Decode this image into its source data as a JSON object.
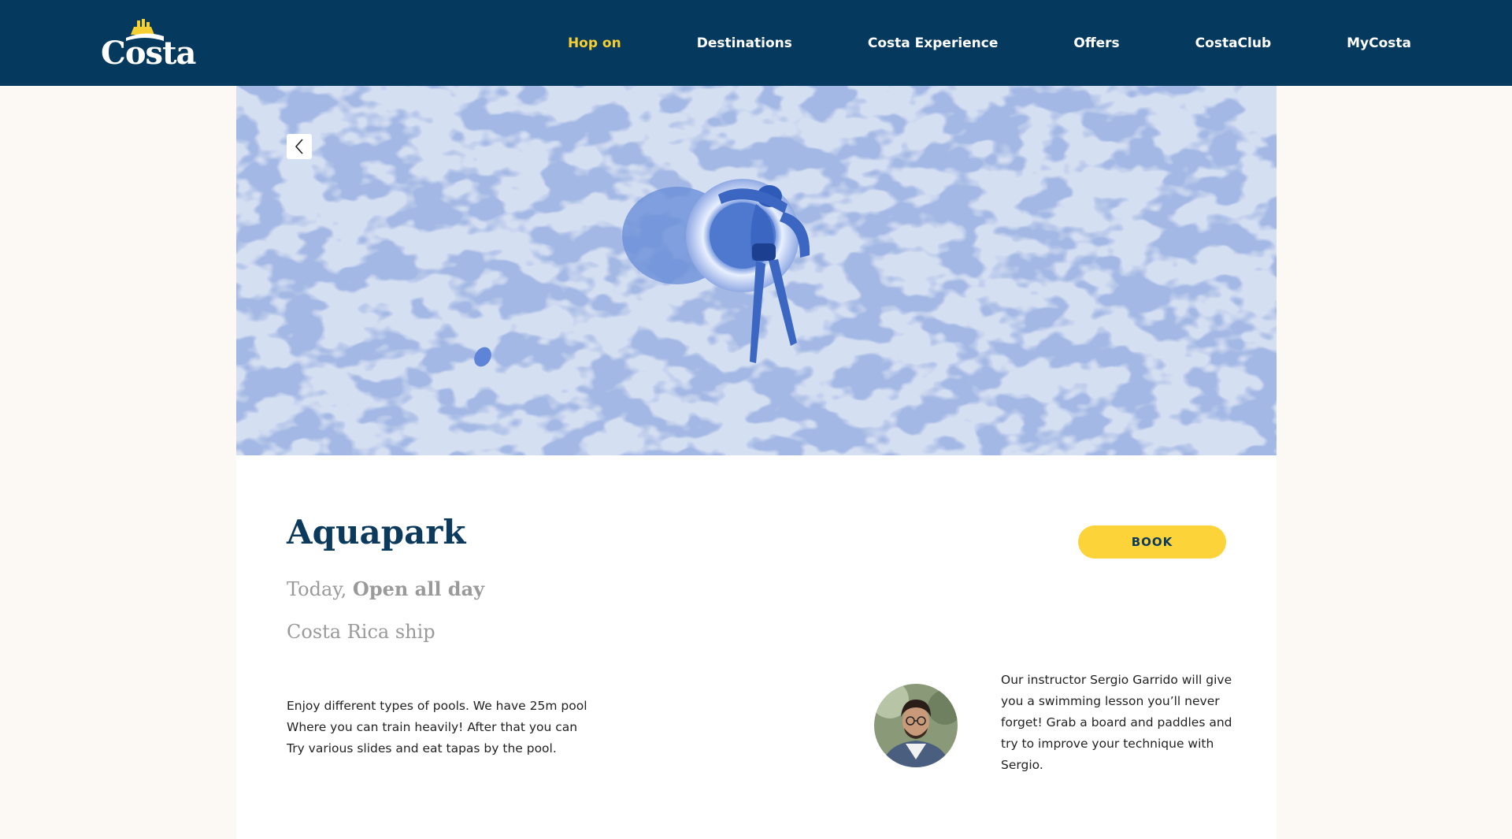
{
  "brand": {
    "logo_text": "Costa",
    "header_color": "#06395e",
    "accent_color": "#f6cf32"
  },
  "nav": {
    "items": [
      {
        "label": "Hop on",
        "active": true
      },
      {
        "label": "Destinations",
        "active": false
      },
      {
        "label": "Costa Experience",
        "active": false
      },
      {
        "label": "Offers",
        "active": false
      },
      {
        "label": "CostaClub",
        "active": false
      },
      {
        "label": "MyCosta",
        "active": false
      }
    ]
  },
  "hero": {
    "prev_icon": "chevron-left-icon"
  },
  "activity": {
    "title": "Aquapark",
    "schedule_prefix": "Today, ",
    "schedule_hours": "Open all day",
    "location": "Costa Rica ship",
    "book_label": "BOOK",
    "description_lines": [
      "Enjoy different types of pools. We have 25m pool",
      "Where you can train heavily! After that you can",
      "Try various slides and eat tapas by the pool."
    ],
    "instructor_lines": [
      "Our instructor Sergio Garrido will give",
      "you a swimming lesson you’ll never",
      "forget! Grab a board and paddles and",
      "try to improve your technique with",
      "Sergio."
    ]
  }
}
